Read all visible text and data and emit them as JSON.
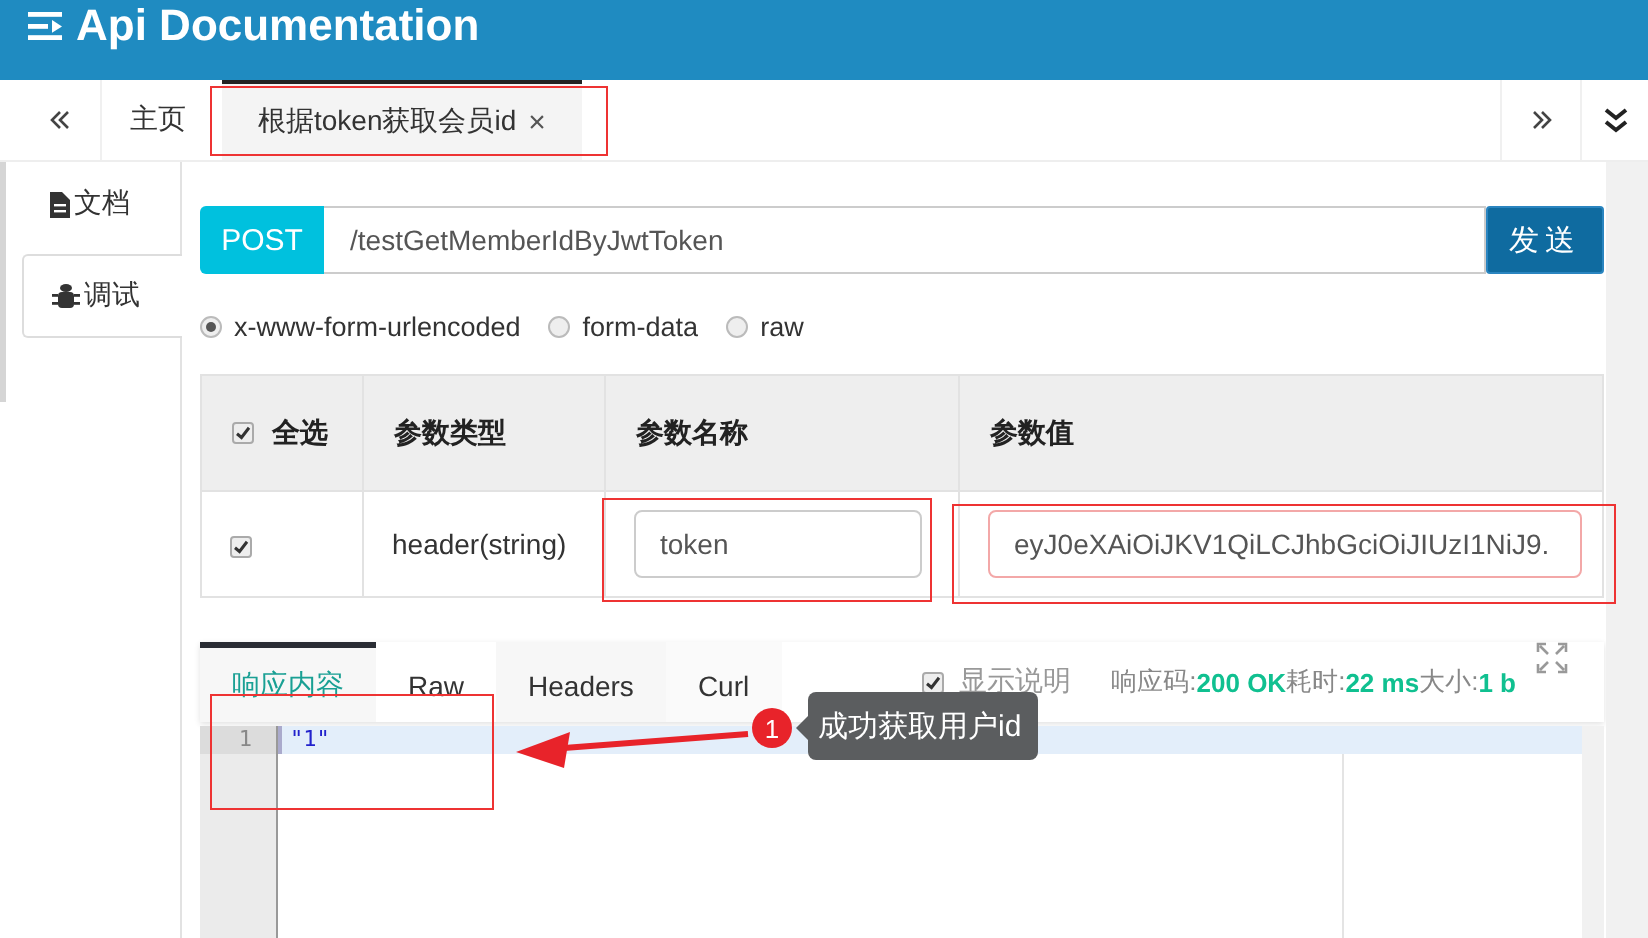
{
  "header": {
    "title": "Api Documentation"
  },
  "tabs": [
    {
      "label": "主页",
      "selected": false
    },
    {
      "label": "根据token获取会员id",
      "selected": true,
      "close": "×"
    }
  ],
  "side_tabs": [
    {
      "label": "文档",
      "kind": "doc",
      "selected": false
    },
    {
      "label": "调试",
      "kind": "debug",
      "selected": true
    }
  ],
  "request": {
    "method": "POST",
    "url": "/testGetMemberIdByJwtToken",
    "send": "发送"
  },
  "body_types": [
    {
      "label": "x-www-form-urlencoded",
      "selected": true
    },
    {
      "label": "form-data",
      "selected": false
    },
    {
      "label": "raw",
      "selected": false
    }
  ],
  "params": {
    "select_all": {
      "label": "全选",
      "checked": true
    },
    "columns": [
      "参数类型",
      "参数名称",
      "参数值"
    ],
    "rows": [
      {
        "checked": true,
        "type": "header(string)",
        "name": "token",
        "value": "eyJ0eXAiOiJKV1QiLCJhbGciOiJIUzI1NiJ9."
      }
    ]
  },
  "response": {
    "tabs": [
      {
        "label": "响应内容",
        "selected": true
      },
      {
        "label": "Raw",
        "selected": false
      },
      {
        "label": "Headers",
        "selected": false
      },
      {
        "label": "Curl",
        "selected": false
      }
    ],
    "show_description": {
      "label": "显示说明",
      "checked": true
    },
    "status": [
      {
        "label": "响应码:",
        "value": "200 OK"
      },
      {
        "label": "耗时:",
        "value": "22 ms"
      },
      {
        "label": "大小:",
        "value": "1 b"
      }
    ],
    "lines": [
      {
        "number": "1",
        "text": "\"1\""
      }
    ]
  },
  "annotation": {
    "badge": "1",
    "callout": "成功获取用户id"
  }
}
